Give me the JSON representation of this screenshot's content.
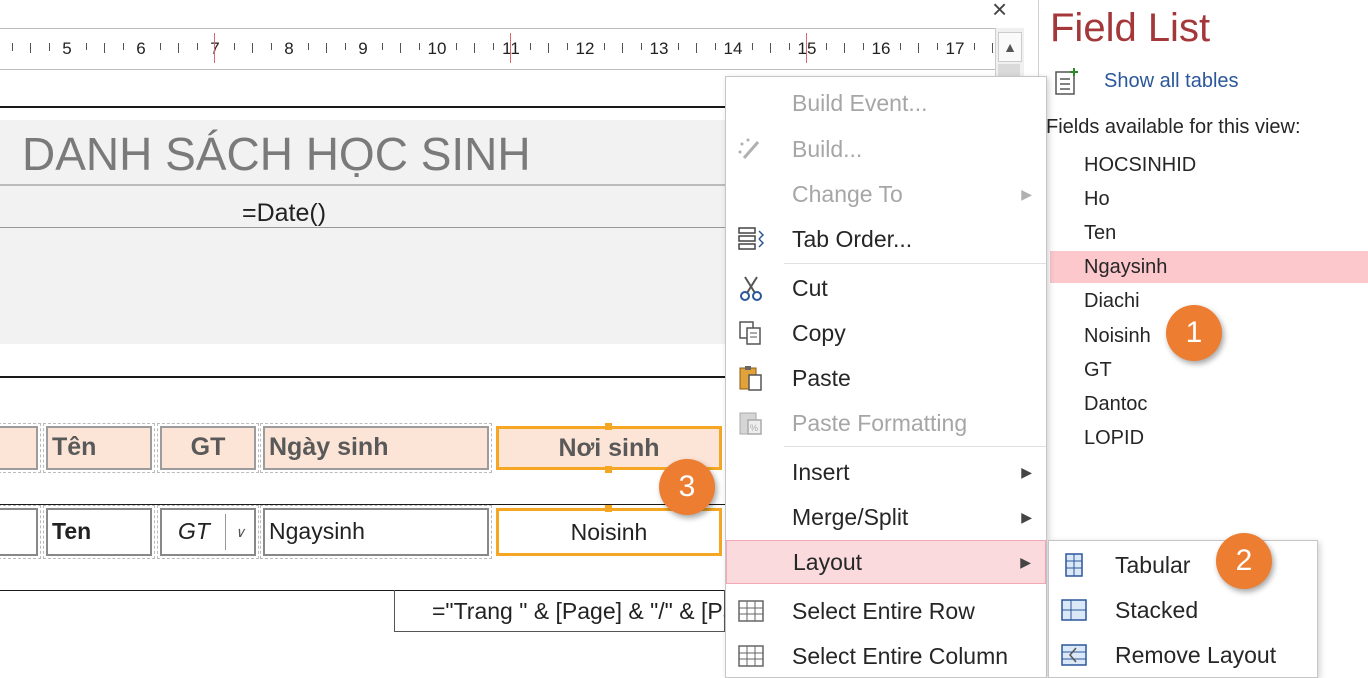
{
  "ruler": {
    "numbers": [
      "5",
      "6",
      "7",
      "8",
      "9",
      "10",
      "11",
      "12",
      "13",
      "14",
      "15",
      "16",
      "17"
    ]
  },
  "report": {
    "title": "DANH SÁCH HỌC SINH",
    "date_expr": "=Date()",
    "header_cells": [
      "Tên",
      "GT",
      "Ngày sinh",
      "Nơi sinh"
    ],
    "detail_cells": [
      "Ten",
      "GT",
      "Ngaysinh",
      "Noisinh"
    ],
    "footer_expr": "=\"Trang \" & [Page] & \"/\" & [Pages]"
  },
  "callouts": [
    "1",
    "2",
    "3"
  ],
  "context_menu": {
    "items": [
      {
        "label": "Build Event...",
        "icon": "lightning-icon",
        "disabled": true
      },
      {
        "label": "Build...",
        "icon": "build-wand-icon",
        "disabled": true
      },
      {
        "label": "Change To",
        "icon": "",
        "disabled": true,
        "submenu": true
      },
      {
        "label": "Tab Order...",
        "icon": "tab-order-icon",
        "disabled": false
      },
      {
        "label": "Cut",
        "icon": "scissors-icon",
        "disabled": false
      },
      {
        "label": "Copy",
        "icon": "copy-icon",
        "disabled": false
      },
      {
        "label": "Paste",
        "icon": "paste-icon",
        "disabled": false
      },
      {
        "label": "Paste Formatting",
        "icon": "paste-formatting-icon",
        "disabled": true
      },
      {
        "label": "Insert",
        "icon": "",
        "disabled": false,
        "submenu": true
      },
      {
        "label": "Merge/Split",
        "icon": "",
        "disabled": false,
        "submenu": true
      },
      {
        "label": "Layout",
        "icon": "",
        "disabled": false,
        "submenu": true,
        "highlighted": true
      },
      {
        "label": "Select Entire Row",
        "icon": "select-row-icon",
        "disabled": false
      },
      {
        "label": "Select Entire Column",
        "icon": "select-column-icon",
        "disabled": false
      }
    ]
  },
  "layout_submenu": {
    "items": [
      {
        "label": "Tabular",
        "icon": "tabular-layout-icon"
      },
      {
        "label": "Stacked",
        "icon": "stacked-layout-icon"
      },
      {
        "label": "Remove Layout",
        "icon": "remove-layout-icon"
      }
    ]
  },
  "field_list": {
    "title": "Field List",
    "show_all": "Show all tables",
    "available_label": "Fields available for this view:",
    "fields": [
      "HOCSINHID",
      "Ho",
      "Ten",
      "Ngaysinh",
      "Diachi",
      "Noisinh",
      "GT",
      "Dantoc",
      "LOPID"
    ],
    "highlighted_field": "Ngaysinh"
  },
  "colors": {
    "accent_orange": "#ed7d31",
    "selection_orange": "#f5a623",
    "title_red": "#a4373a",
    "menu_highlight": "#fadadd"
  }
}
